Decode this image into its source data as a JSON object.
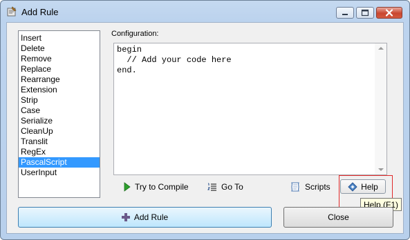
{
  "window": {
    "title": "Add Rule"
  },
  "rules": {
    "items": [
      "Insert",
      "Delete",
      "Remove",
      "Replace",
      "Rearrange",
      "Extension",
      "Strip",
      "Case",
      "Serialize",
      "CleanUp",
      "Translit",
      "RegEx",
      "PascalScript",
      "UserInput"
    ],
    "selected": "PascalScript"
  },
  "config": {
    "label": "Configuration:",
    "code": "begin\n  // Add your code here\nend."
  },
  "toolbar": {
    "try_compile": "Try to Compile",
    "go_to": "Go To",
    "scripts": "Scripts",
    "help": "Help"
  },
  "tooltip": {
    "help": "Help (F1)"
  },
  "buttons": {
    "add_rule": "Add Rule",
    "close": "Close"
  },
  "colors": {
    "selection": "#3399ff",
    "highlight": "#e02828",
    "tooltip_bg": "#ffffe1"
  }
}
